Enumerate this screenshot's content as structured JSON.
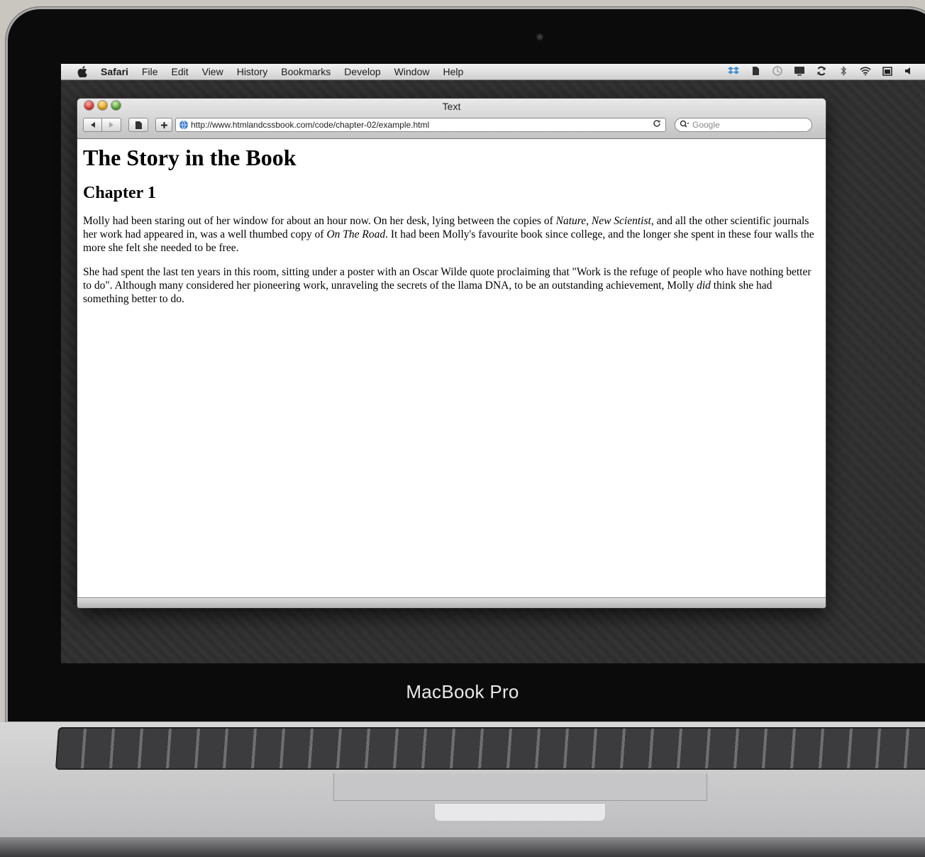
{
  "menubar": {
    "items": [
      "Safari",
      "File",
      "Edit",
      "View",
      "History",
      "Bookmarks",
      "Develop",
      "Window",
      "Help"
    ]
  },
  "window": {
    "title": "Text",
    "url": "http://www.htmlandcssbook.com/code/chapter-02/example.html",
    "search_placeholder": "Google"
  },
  "page": {
    "heading": "The Story in the Book",
    "subheading": "Chapter 1",
    "p1_a": "Molly had been staring out of her window for about an hour now. On her desk, lying between the copies of ",
    "p1_em1": "Nature",
    "p1_b": ", ",
    "p1_em2": "New Scientist",
    "p1_c": ", and all the other scientific journals her work had appeared in, was a well thumbed copy of ",
    "p1_em3": "On The Road",
    "p1_d": ". It had been Molly's favourite book since college, and the longer she spent in these four walls the more she felt she needed to be free.",
    "p2_a": "She had spent the last ten years in this room, sitting under a poster with an Oscar Wilde quote proclaiming that \"Work is the refuge of people who have nothing better to do\". Although many considered her pioneering work, unraveling the secrets of the llama DNA, to be an outstanding achievement, Molly ",
    "p2_em": "did",
    "p2_b": " think she had something better to do."
  },
  "device": {
    "brand": "MacBook Pro"
  }
}
